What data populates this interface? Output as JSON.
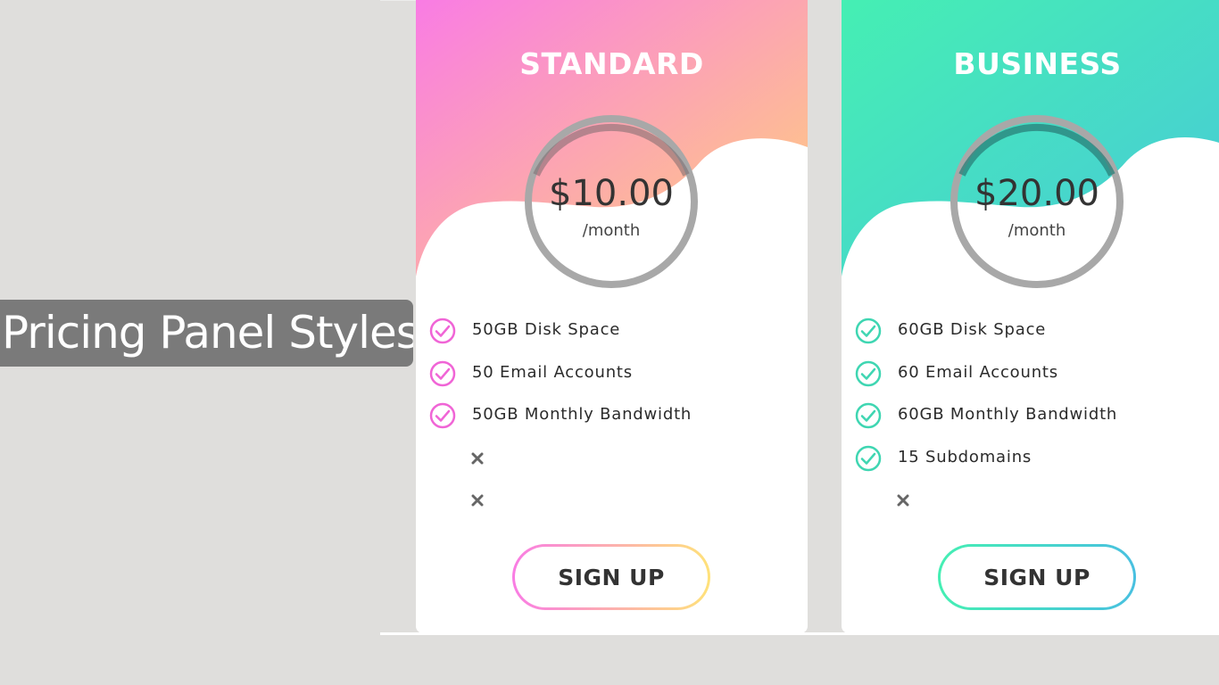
{
  "overlay": {
    "title": "Pricing Panel Styles"
  },
  "plans": [
    {
      "name": "STANDARD",
      "price": "$10.00",
      "period": "/month",
      "features": [
        {
          "label": "50GB Disk Space",
          "included": true
        },
        {
          "label": "50 Email Accounts",
          "included": true
        },
        {
          "label": "50GB Monthly Bandwidth",
          "included": true
        },
        {
          "label": "",
          "included": false
        },
        {
          "label": "",
          "included": false
        }
      ],
      "cta": "SIGN UP",
      "colors": {
        "gradient_start": "#f97ce4",
        "gradient_end": "#ffd27a",
        "check": "#f065d6"
      }
    },
    {
      "name": "BUSINESS",
      "price": "$20.00",
      "period": "/month",
      "features": [
        {
          "label": "60GB Disk Space",
          "included": true
        },
        {
          "label": "60 Email Accounts",
          "included": true
        },
        {
          "label": "60GB Monthly Bandwidth",
          "included": true
        },
        {
          "label": "15 Subdomains",
          "included": true
        },
        {
          "label": "",
          "included": false
        }
      ],
      "cta": "SIGN UP",
      "colors": {
        "gradient_start": "#45efb3",
        "gradient_end": "#48c9d8",
        "check": "#3fd6b2"
      }
    }
  ],
  "icons": {
    "included": "check-circle-icon",
    "excluded": "x-icon"
  }
}
